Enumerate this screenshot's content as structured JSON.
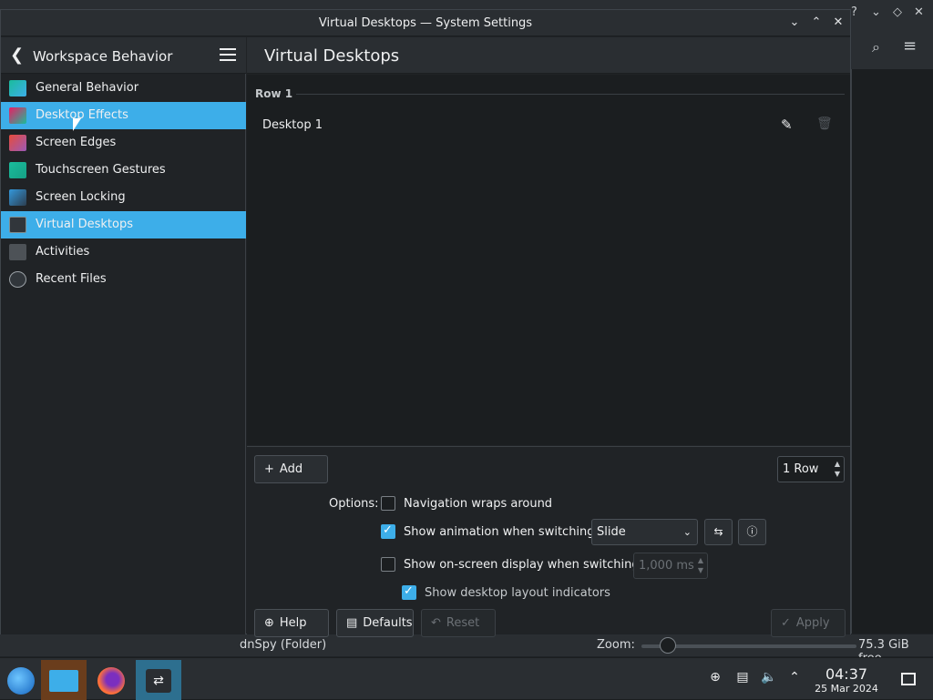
{
  "window": {
    "title": "Virtual Desktops — System Settings"
  },
  "sidebar": {
    "title": "Workspace Behavior",
    "items": [
      {
        "label": "General Behavior"
      },
      {
        "label": "Desktop Effects"
      },
      {
        "label": "Screen Edges"
      },
      {
        "label": "Touchscreen Gestures"
      },
      {
        "label": "Screen Locking"
      },
      {
        "label": "Virtual Desktops"
      },
      {
        "label": "Activities"
      },
      {
        "label": "Recent Files"
      }
    ]
  },
  "content": {
    "title": "Virtual Desktops",
    "row_label": "Row 1",
    "desktops": [
      {
        "label": "Desktop 1"
      }
    ]
  },
  "controls": {
    "add_label": "Add",
    "rows_value": "1 Row",
    "options_label": "Options:",
    "nav_wraps_label": "Navigation wraps around",
    "nav_wraps_checked": false,
    "show_anim_label": "Show animation when switching:",
    "show_anim_checked": true,
    "anim_value": "Slide",
    "show_osd_label": "Show on-screen display when switching:",
    "show_osd_checked": false,
    "osd_ms_value": "1,000 ms",
    "show_indicators_label": "Show desktop layout indicators",
    "show_indicators_checked": true,
    "help_label": "Help",
    "defaults_label": "Defaults",
    "reset_label": "Reset",
    "apply_label": "Apply"
  },
  "background_app": {
    "status_folder": "dnSpy (Folder)",
    "zoom_label": "Zoom:",
    "free_space": "75.3 GiB free"
  },
  "taskbar": {
    "time": "04:37",
    "date": "25 Mar 2024"
  },
  "colors": {
    "accent": "#3daee9",
    "window_bg": "#202326",
    "header_bg": "#2a2e32"
  }
}
